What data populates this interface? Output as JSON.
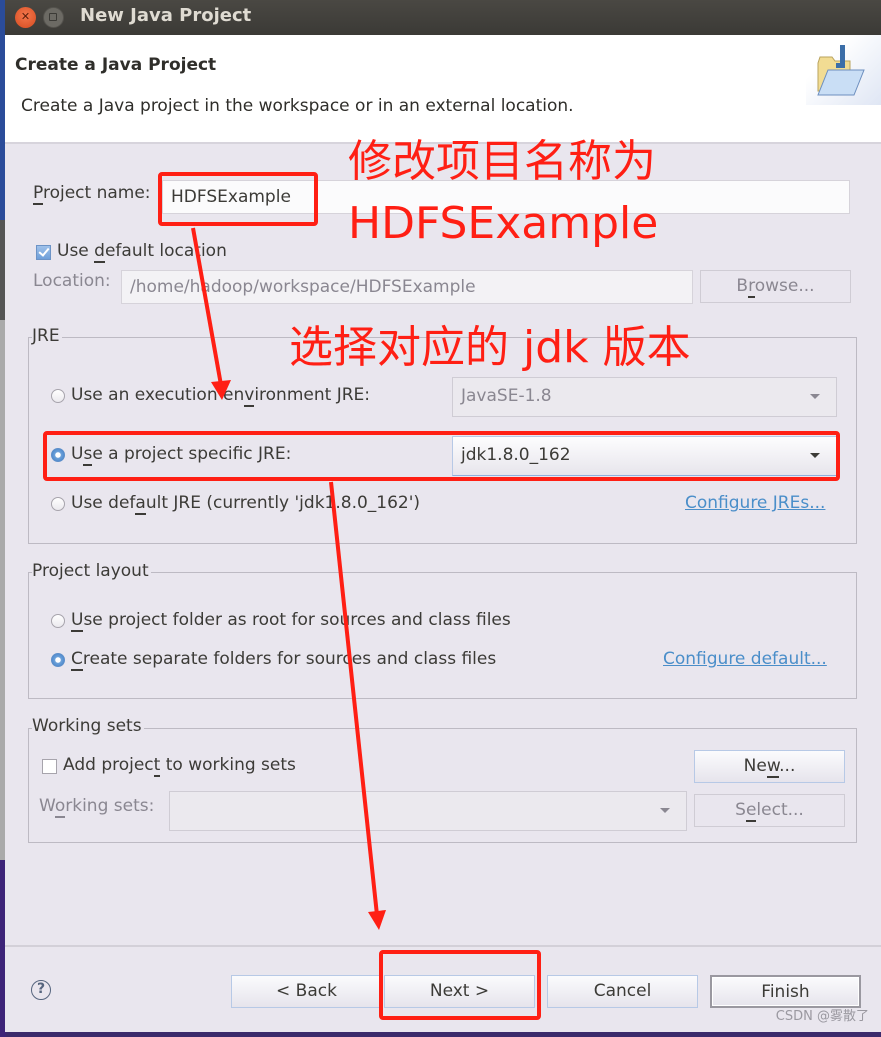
{
  "window": {
    "title": "New Java Project"
  },
  "header": {
    "title": "Create a Java Project",
    "description": "Create a Java project in the workspace or in an external location.",
    "icon": "new-java-project-folder-icon"
  },
  "project": {
    "name_label_pre": "",
    "name_label_mn": "P",
    "name_label_post": "roject name:",
    "name_value": "HDFSExample",
    "use_default_pre": "Use ",
    "use_default_mn": "d",
    "use_default_post": "efault location",
    "use_default_checked": true,
    "location_label": "Location:",
    "location_value": "/home/hadoop/workspace/HDFSExample",
    "browse_pre": "B",
    "browse_mn": "r",
    "browse_post": "owse..."
  },
  "jre": {
    "group_title": "JRE",
    "options": [
      {
        "pre": "Use an execution en",
        "mn": "v",
        "post": "ironment JRE:",
        "selected": false
      },
      {
        "pre": "U",
        "mn": "s",
        "post": "e a project specific JRE:",
        "selected": true
      },
      {
        "pre": "Use def",
        "mn": "a",
        "post": "ult JRE (currently 'jdk1.8.0_162')",
        "selected": false
      }
    ],
    "execution_env_value": "JavaSE-1.8",
    "project_jre_value": "jdk1.8.0_162",
    "configure_link": "Configure JREs..."
  },
  "layout": {
    "group_title": "Project layout",
    "options": [
      {
        "pre": "",
        "mn": "U",
        "post": "se project folder as root for sources and class files",
        "selected": false
      },
      {
        "pre": "",
        "mn": "C",
        "post": "reate separate folders for sources and class files",
        "selected": true
      }
    ],
    "configure_link": "Configure default..."
  },
  "working_sets": {
    "group_title": "Working sets",
    "add_pre": "Add projec",
    "add_mn": "t",
    "add_post": " to working sets",
    "add_checked": false,
    "label_pre": "W",
    "label_mn": "o",
    "label_post": "rking sets:",
    "value": "",
    "new_pre": "Ne",
    "new_mn": "w",
    "new_post": "...",
    "select_pre": "S",
    "select_mn": "e",
    "select_post": "lect..."
  },
  "footer": {
    "help": "?",
    "back": "< Back",
    "next": "Next >",
    "cancel": "Cancel",
    "finish": "Finish"
  },
  "annotations": {
    "rename_line1": "修改项目名称为",
    "rename_line2": "HDFSExample",
    "jdk_note": "选择对应的 jdk 版本",
    "color": "#ff1f14"
  },
  "watermark": "CSDN @雾散了"
}
